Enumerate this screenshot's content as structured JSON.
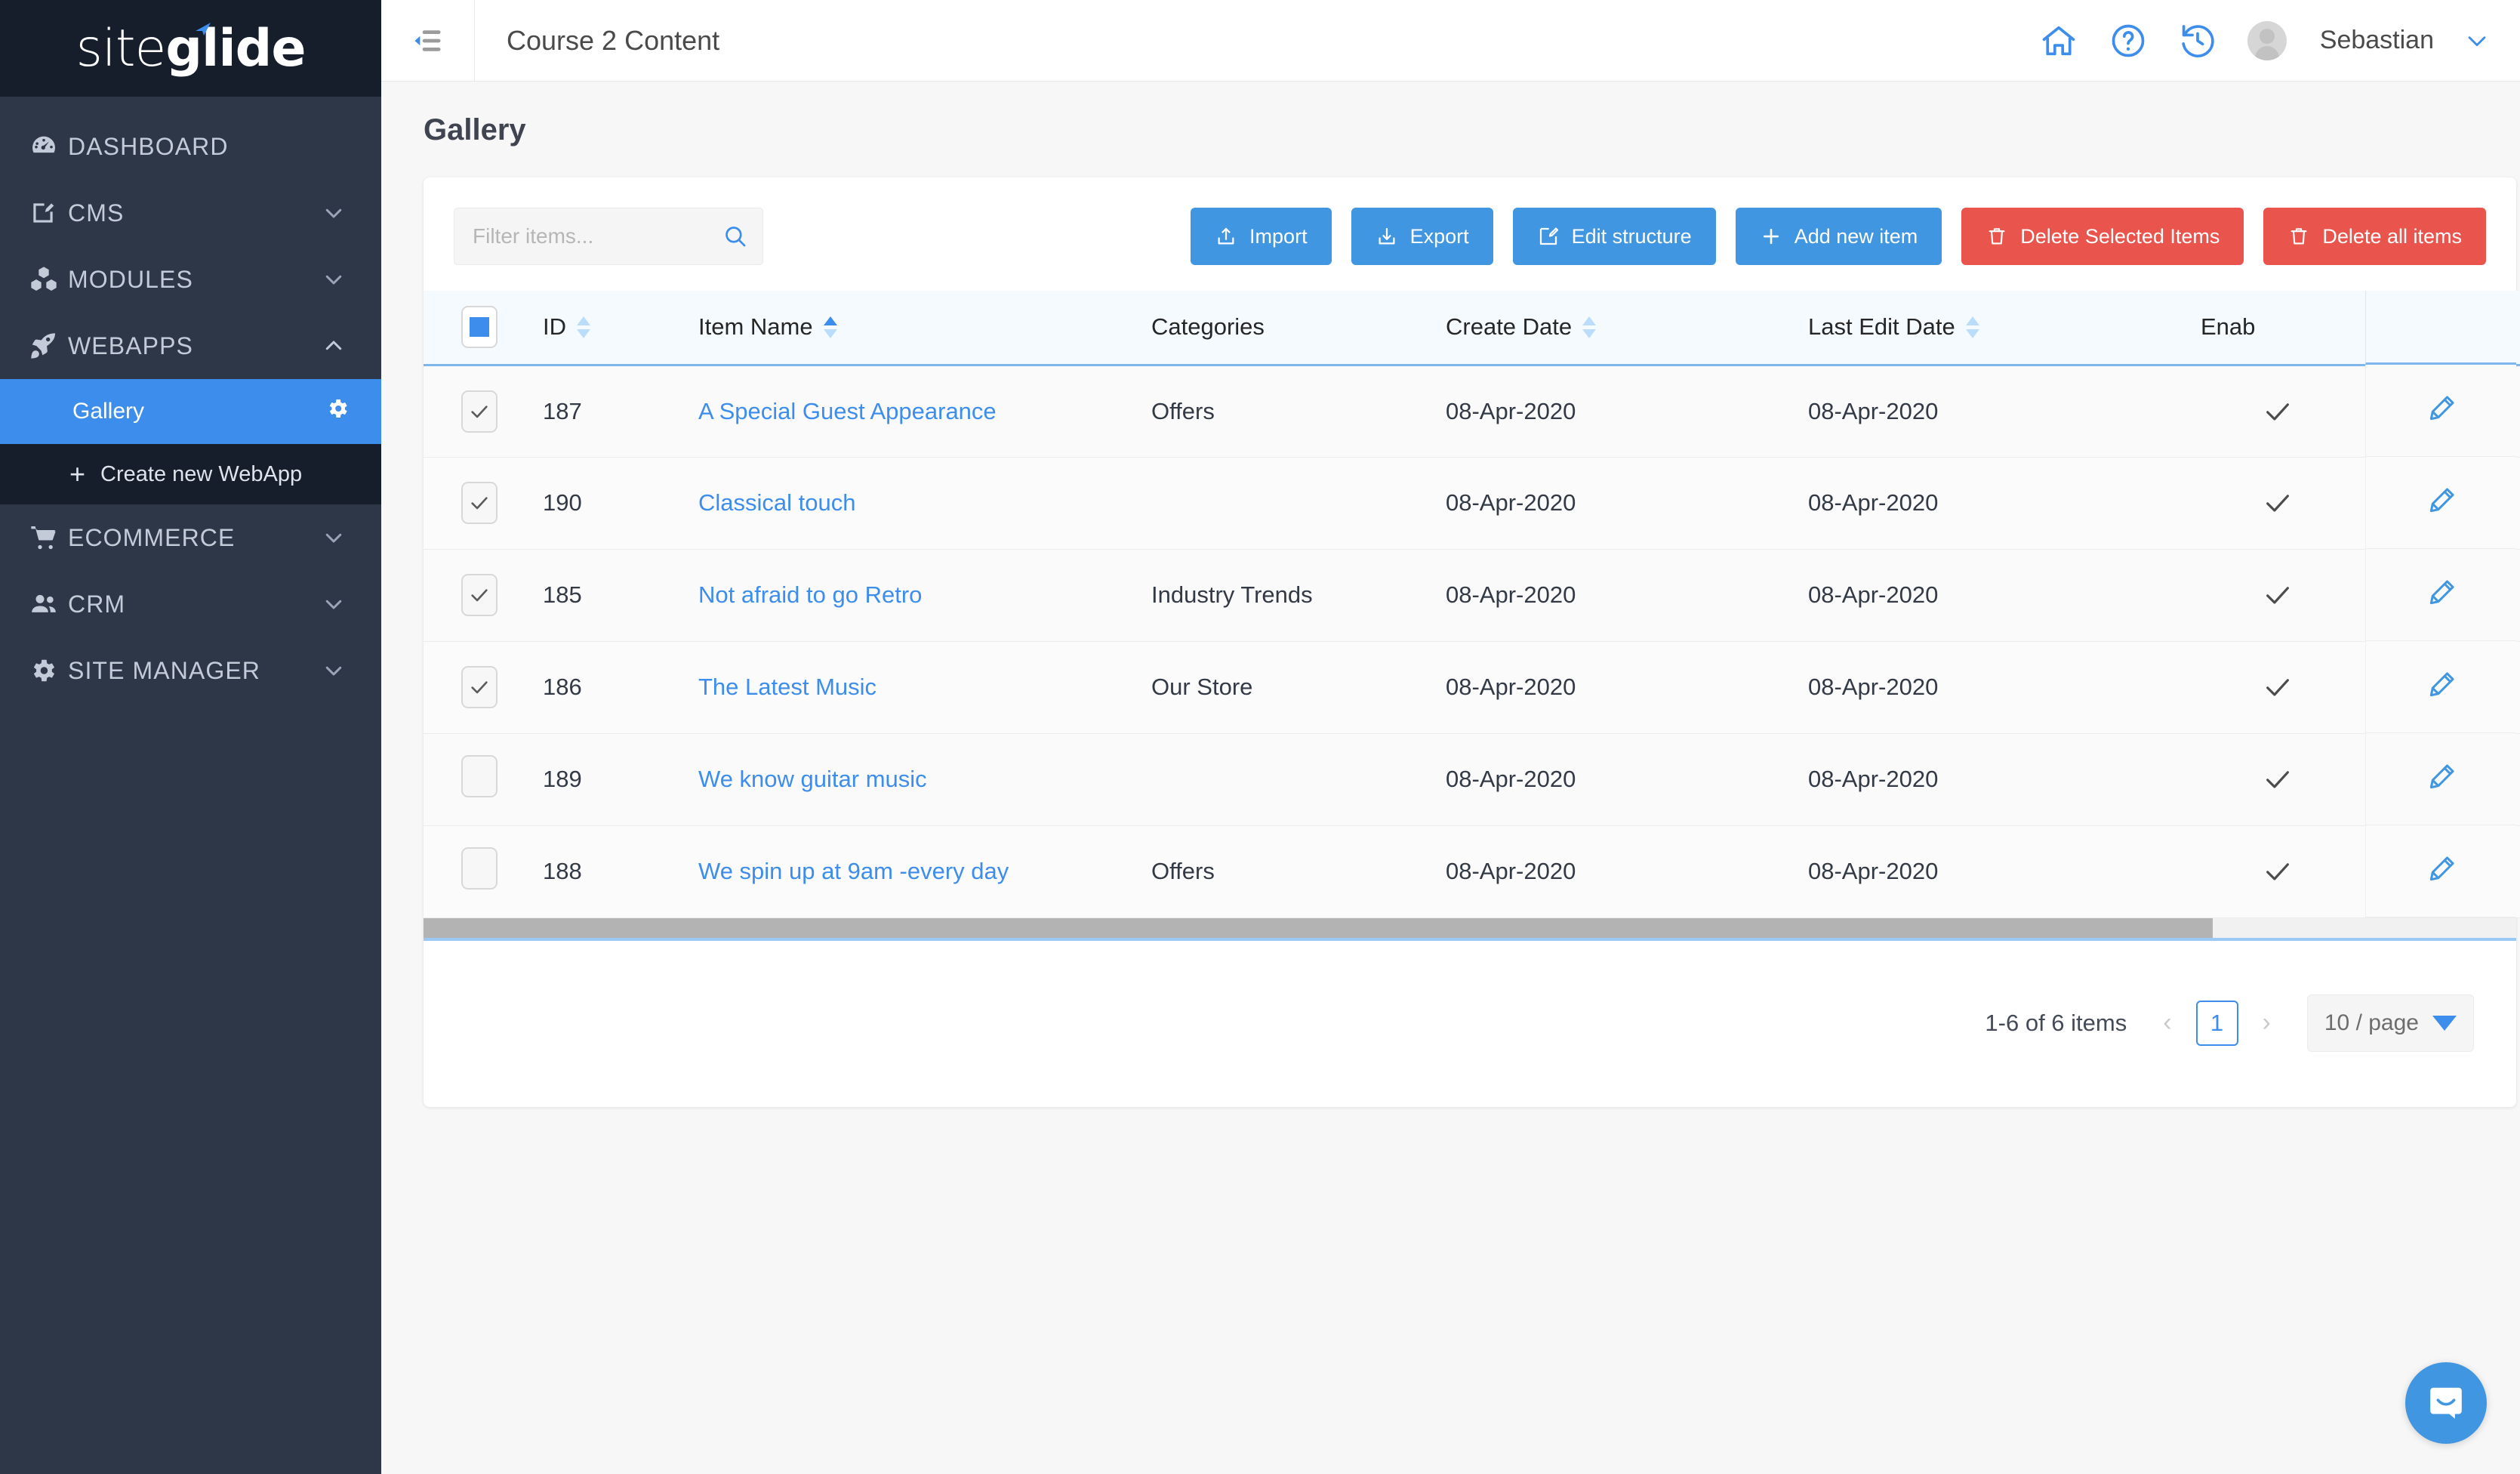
{
  "brand": {
    "light": "site",
    "bold": "glide",
    "plane_icon": "paper-plane-icon"
  },
  "sidebar": {
    "items": [
      {
        "label": "DASHBOARD",
        "icon": "speedometer-icon",
        "expandable": false
      },
      {
        "label": "CMS",
        "icon": "edit-square-icon",
        "expandable": true,
        "state": "collapsed"
      },
      {
        "label": "MODULES",
        "icon": "blocks-icon",
        "expandable": true,
        "state": "collapsed"
      },
      {
        "label": "WEBAPPS",
        "icon": "rocket-icon",
        "expandable": true,
        "state": "expanded"
      }
    ],
    "webapps_children": {
      "active": {
        "label": "Gallery",
        "gear_icon": "gear-icon"
      },
      "create": {
        "label": "Create new WebApp",
        "plus": "+"
      }
    },
    "items_bottom": [
      {
        "label": "ECOMMERCE",
        "icon": "cart-icon",
        "expandable": true,
        "state": "collapsed"
      },
      {
        "label": "CRM",
        "icon": "users-icon",
        "expandable": true,
        "state": "collapsed"
      },
      {
        "label": "SITE MANAGER",
        "icon": "gear-icon",
        "expandable": true,
        "state": "collapsed"
      }
    ]
  },
  "topbar": {
    "collapse_icon": "sidebar-collapse-icon",
    "context_title": "Course 2 Content",
    "home_icon": "home-icon",
    "help_icon": "question-circle-icon",
    "history_icon": "history-icon",
    "user_name": "Sebastian",
    "user_caret_icon": "chevron-down-icon"
  },
  "page": {
    "title": "Gallery"
  },
  "toolbar": {
    "filter_placeholder": "Filter items...",
    "filter_value": "",
    "search_icon": "search-icon",
    "buttons": [
      {
        "label": "Import",
        "icon": "upload-icon",
        "style": "blue"
      },
      {
        "label": "Export",
        "icon": "download-icon",
        "style": "blue"
      },
      {
        "label": "Edit structure",
        "icon": "pencil-square-icon",
        "style": "blue"
      },
      {
        "label": "Add new item",
        "icon": "plus-icon",
        "style": "blue"
      },
      {
        "label": "Delete Selected Items",
        "icon": "trash-icon",
        "style": "red"
      },
      {
        "label": "Delete all items",
        "icon": "trash-icon",
        "style": "red"
      }
    ]
  },
  "table": {
    "select_all_state": "indeterminate",
    "columns": [
      {
        "key": "id",
        "label": "ID",
        "sortable": true,
        "sort": "none"
      },
      {
        "key": "name",
        "label": "Item Name",
        "sortable": true,
        "sort": "asc"
      },
      {
        "key": "categories",
        "label": "Categories",
        "sortable": false
      },
      {
        "key": "create_date",
        "label": "Create Date",
        "sortable": true,
        "sort": "none"
      },
      {
        "key": "last_edit_date",
        "label": "Last Edit Date",
        "sortable": true,
        "sort": "none"
      },
      {
        "key": "enabled",
        "label": "Enab",
        "sortable": false
      }
    ],
    "rows": [
      {
        "checked": true,
        "id": "187",
        "name": "A Special Guest Appearance",
        "categories": "Offers",
        "create_date": "08-Apr-2020",
        "last_edit_date": "08-Apr-2020",
        "enabled": true,
        "edit_icon": "pencil-icon"
      },
      {
        "checked": true,
        "id": "190",
        "name": "Classical touch",
        "categories": "",
        "create_date": "08-Apr-2020",
        "last_edit_date": "08-Apr-2020",
        "enabled": true,
        "edit_icon": "pencil-icon"
      },
      {
        "checked": true,
        "id": "185",
        "name": "Not afraid to go Retro",
        "categories": "Industry Trends",
        "create_date": "08-Apr-2020",
        "last_edit_date": "08-Apr-2020",
        "enabled": true,
        "edit_icon": "pencil-icon"
      },
      {
        "checked": true,
        "id": "186",
        "name": "The Latest Music",
        "categories": "Our Store",
        "create_date": "08-Apr-2020",
        "last_edit_date": "08-Apr-2020",
        "enabled": true,
        "edit_icon": "pencil-icon"
      },
      {
        "checked": false,
        "id": "189",
        "name": "We know guitar music",
        "categories": "",
        "create_date": "08-Apr-2020",
        "last_edit_date": "08-Apr-2020",
        "enabled": true,
        "edit_icon": "pencil-icon"
      },
      {
        "checked": false,
        "id": "188",
        "name": "We spin up at 9am -every day",
        "categories": "Offers",
        "create_date": "08-Apr-2020",
        "last_edit_date": "08-Apr-2020",
        "enabled": true,
        "edit_icon": "pencil-icon"
      }
    ]
  },
  "pagination": {
    "info": "1-6 of 6 items",
    "prev": "‹",
    "next": "›",
    "current_page": "1",
    "page_size": "10 / page",
    "caret_icon": "caret-down-icon"
  },
  "chat": {
    "icon": "intercom-chat-icon"
  },
  "colors": {
    "accent": "#3c8dec",
    "button_blue": "#4096e0",
    "button_red": "#e9544c",
    "sidebar_bg": "#2e3748",
    "sidebar_dark": "#161d2b",
    "header_row": "#f5faff"
  }
}
